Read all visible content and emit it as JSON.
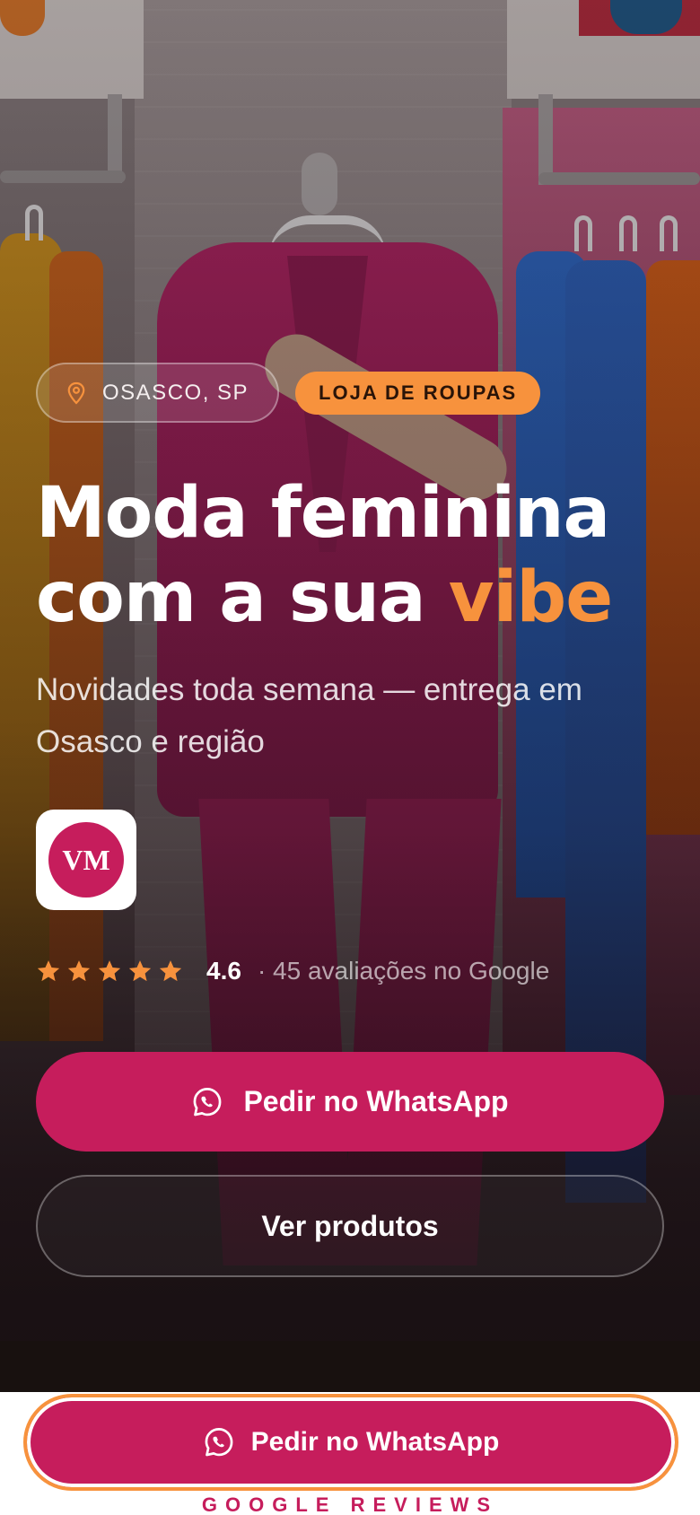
{
  "hero": {
    "location_badge": "OSASCO, SP",
    "category_badge": "LOJA DE ROUPAS",
    "headline_line1": "Moda feminina",
    "headline_line2_prefix": "com a sua ",
    "headline_accent": "vibe",
    "subtitle": "Novidades toda semana — entrega em Osasco e região",
    "logo_text": "VM"
  },
  "rating": {
    "stars": 5,
    "value": "4.6",
    "label": "· 45 avaliações no Google"
  },
  "buttons": {
    "primary": "Pedir no WhatsApp",
    "secondary": "Ver produtos"
  },
  "sticky": {
    "cta": "Pedir no WhatsApp"
  },
  "footer": {
    "section_label": "GOOGLE REVIEWS"
  },
  "icons": {
    "location": "map-pin-icon",
    "star": "star-icon",
    "whatsapp": "whatsapp-icon"
  },
  "colors": {
    "brand": "#c61d5c",
    "accent": "#f7923d"
  }
}
